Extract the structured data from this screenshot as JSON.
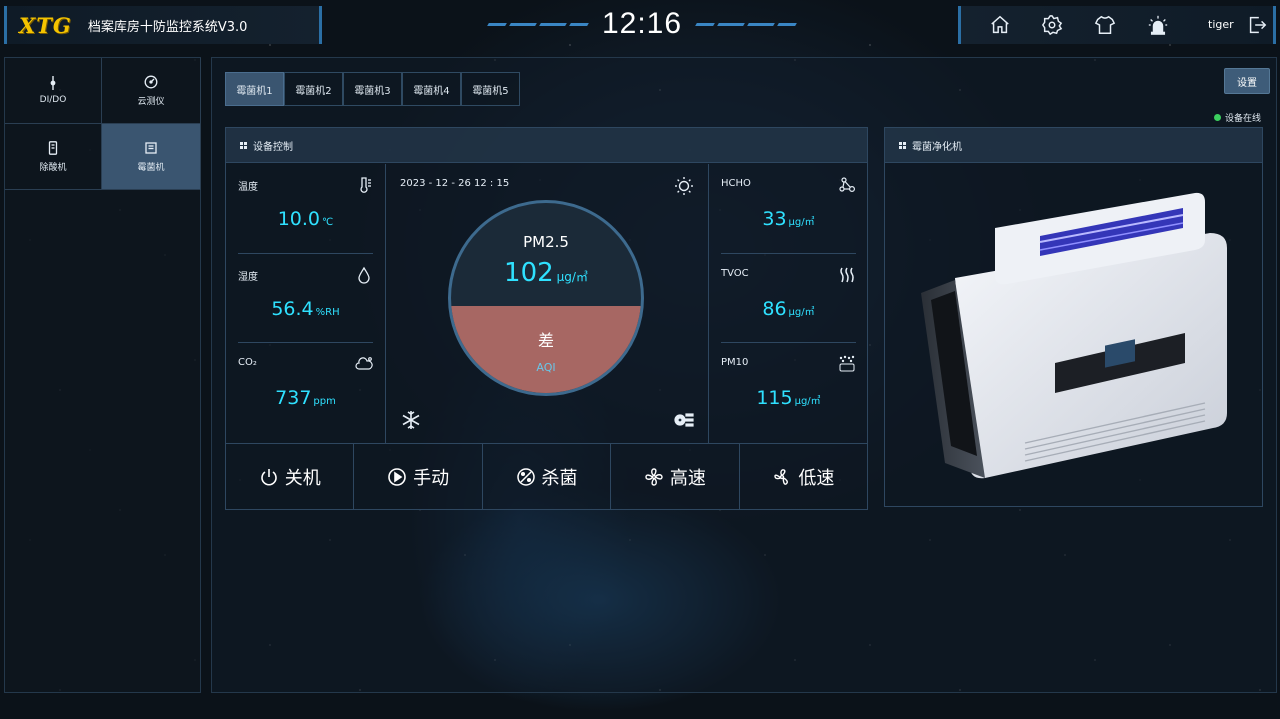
{
  "header": {
    "logo_text": "XTG",
    "title": "档案库房十防监控系统V3.0",
    "clock": "12:16",
    "username": "tiger",
    "icons": [
      "home-icon",
      "gear-icon",
      "shirt-icon",
      "alarm-icon",
      "logout-icon"
    ]
  },
  "leftnav": {
    "items": [
      {
        "label": "DI/DO",
        "icon": "dido-icon"
      },
      {
        "label": "云测仪",
        "icon": "gauge-icon"
      },
      {
        "label": "除酸机",
        "icon": "deacid-icon"
      },
      {
        "label": "霉菌机",
        "icon": "mold-icon"
      }
    ],
    "active_index": 3
  },
  "main": {
    "tabs": [
      "霉菌机1",
      "霉菌机2",
      "霉菌机3",
      "霉菌机4",
      "霉菌机5"
    ],
    "active_tab": 0,
    "settings_label": "设置",
    "status_text": "设备在线",
    "status_color": "#3bcf5e",
    "control_card": {
      "title": "设备控制",
      "datetime": "2023 - 12 - 26   12 : 15",
      "metrics_left": [
        {
          "label": "温度",
          "value": "10.0",
          "unit": "℃",
          "icon": "thermometer-icon"
        },
        {
          "label": "湿度",
          "value": "56.4",
          "unit": "%RH",
          "icon": "droplet-icon"
        },
        {
          "label": "CO₂",
          "value": "737",
          "unit": "ppm",
          "icon": "co2-cloud-icon"
        }
      ],
      "metrics_right": [
        {
          "label": "HCHO",
          "value": "33",
          "unit": "μg/㎥",
          "icon": "molecule-icon"
        },
        {
          "label": "TVOC",
          "value": "86",
          "unit": "μg/㎥",
          "icon": "waves-icon"
        },
        {
          "label": "PM10",
          "value": "115",
          "unit": "μg/㎥",
          "icon": "pm10-icon"
        }
      ],
      "gauge": {
        "label": "PM2.5",
        "value": "102",
        "unit": "μg/㎥",
        "level": "差",
        "aqi_label": "AQI",
        "fill_fraction": 0.46,
        "fill_color": "#a76763"
      },
      "actions": [
        {
          "label": "关机",
          "icon": "power-icon"
        },
        {
          "label": "手动",
          "icon": "play-icon"
        },
        {
          "label": "杀菌",
          "icon": "sterilize-icon"
        },
        {
          "label": "高速",
          "icon": "fan-high-icon"
        },
        {
          "label": "低速",
          "icon": "fan-low-icon"
        }
      ]
    },
    "device_card": {
      "title": "霉菌净化机"
    }
  },
  "colors": {
    "accent": "#2fe1ff",
    "brand_yellow": "#f5c400",
    "active_tab": "#3a5570"
  }
}
